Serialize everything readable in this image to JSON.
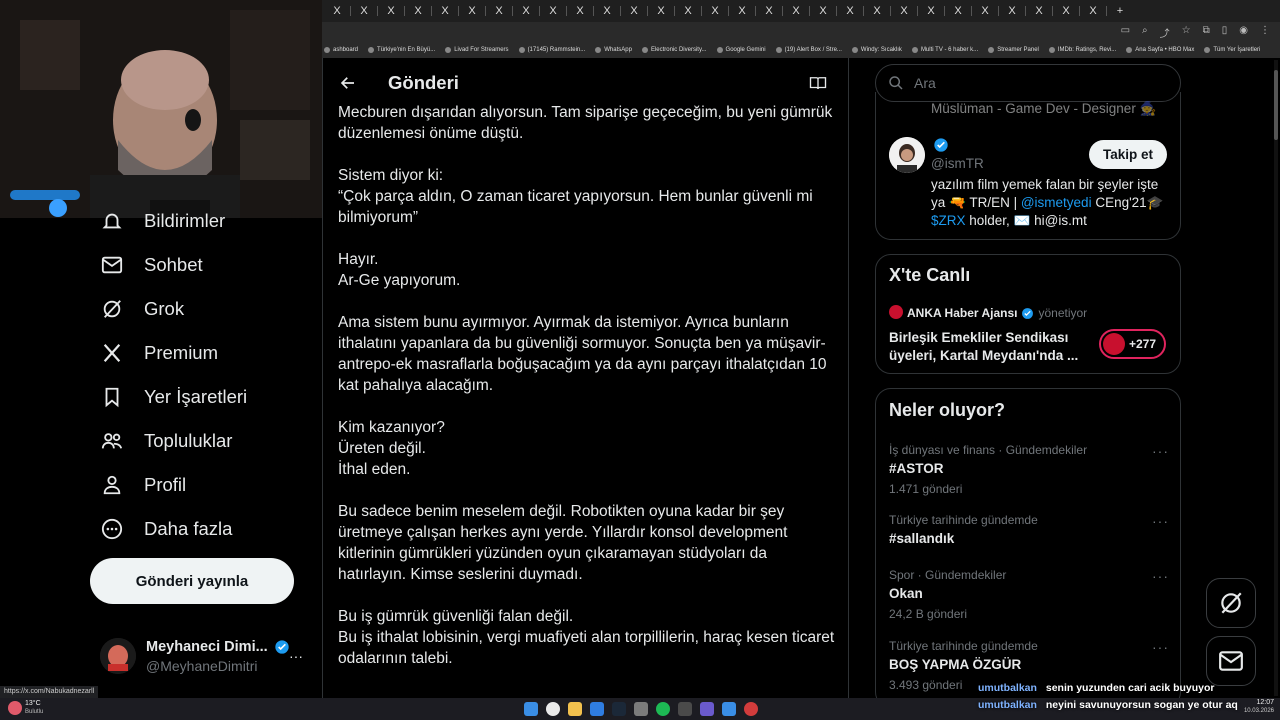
{
  "browser": {
    "tab_close_glyph": "X",
    "new_tab_glyph": "+",
    "bookmarks": [
      "ashboard",
      "Türkiye'nin En Büyü...",
      "Livad For Streamers",
      "(17145) Rammstein...",
      "WhatsApp",
      "Electronic Diversity...",
      "Google Gemini",
      "(19) Alert Box / Stre...",
      "Windy: Sıcaklık",
      "Multi TV - 6 haber k...",
      "Streamer Panel",
      "IMDb: Ratings, Revi...",
      "Ana Sayfa • HBO Max",
      "Tüm Yer İşaretleri"
    ]
  },
  "nav": {
    "items": [
      {
        "label": "Bildirimler",
        "icon": "bell-icon"
      },
      {
        "label": "Sohbet",
        "icon": "envelope-icon"
      },
      {
        "label": "Grok",
        "icon": "grok-icon"
      },
      {
        "label": "Premium",
        "icon": "x-logo-icon"
      },
      {
        "label": "Yer İşaretleri",
        "icon": "bookmark-icon"
      },
      {
        "label": "Topluluklar",
        "icon": "communities-icon"
      },
      {
        "label": "Profil",
        "icon": "person-icon"
      },
      {
        "label": "Daha fazla",
        "icon": "more-circle-icon"
      }
    ],
    "post_button": "Gönderi yayınla",
    "account": {
      "name": "Meyhaneci Dimi...",
      "handle": "@MeyhaneDimitri",
      "more": "···"
    }
  },
  "header": {
    "title": "Gönderi"
  },
  "post": {
    "paragraphs": [
      "Mecburen dışarıdan alıyorsun. Tam siparişe geçeceğim, bu yeni gümrük düzenlemesi önüme düştü.",
      "Sistem diyor ki:\n“Çok parça aldın, O zaman ticaret yapıyorsun. Hem bunlar güvenli mi bilmiyorum”",
      "Hayır.\nAr-Ge yapıyorum.",
      "Ama sistem bunu ayırmıyor. Ayırmak da istemiyor. Ayrıca bunların ithalatını yapanlara da bu güvenliği sormuyor. Sonuçta ben ya müşavir-antrepo-ek masraflarla boğuşacağım ya da aynı parçayı ithalatçıdan 10 kat pahalıya alacağım.",
      "Kim kazanıyor?\nÜreten değil.\nİthal eden.",
      "Bu sadece benim meselem değil. Robotikten oyuna kadar bir şey üretmeye çalışan herkes aynı yerde. Yıllardır konsol development kitlerinin gümrükleri yüzünden oyun çıkaramayan stüdyoları da hatırlayın. Kimse seslerini duymadı.",
      "Bu iş gümrük güvenliği falan değil.\nBu iş ithalat lobisinin, vergi muafiyeti alan torpillilerin, haraç kesen ticaret odalarının talebi."
    ]
  },
  "right": {
    "search_placeholder": "Ara",
    "bio_top": "Müslüman - Game Dev - Designer 🧙",
    "follow_user": {
      "handle": "@ismTR",
      "follow_button": "Takip et",
      "bio_pre": "yazılım film yemek falan bir şeyler işte ya 🔫 TR/EN | ",
      "bio_mention": "@ismetyedi",
      "bio_mid": " CEng'21🎓",
      "bio_cashtag": "$ZRX",
      "bio_post": " holder, ✉️ hi@is.mt"
    },
    "live": {
      "title": "X'te Canlı",
      "host": "ANKA Haber Ajansı",
      "host_role": "yönetiyor",
      "headline": "Birleşik Emekliler Sendikası üyeleri, Kartal Meydanı'nda ...",
      "listeners": "+277"
    },
    "trends_title": "Neler oluyor?",
    "trends": [
      {
        "meta": "İş dünyası ve finans · Gündemdekiler",
        "name": "#ASTOR",
        "count": "1.471 gönderi"
      },
      {
        "meta": "Türkiye tarihinde gündemde",
        "name": "#sallandık",
        "count": ""
      },
      {
        "meta": "Spor · Gündemdekiler",
        "name": "Okan",
        "count": "24,2 B gönderi"
      },
      {
        "meta": "Türkiye tarihinde gündemde",
        "name": "BOŞ YAPMA ÖZGÜR",
        "count": "3.493 gönderi"
      }
    ],
    "more_glyph": "···"
  },
  "chat": [
    {
      "user": "umutbalkan",
      "msg": "senin yuzunden cari acik buyuyor"
    },
    {
      "user": "umutbalkan",
      "msg": "neyini savunuyorsun sogan ye otur aq"
    }
  ],
  "status_url": "https://x.com/Nabukadnezarll",
  "taskbar": {
    "weather_temp": "13°C",
    "weather_desc": "Bulutlu",
    "time": "12:07",
    "date": "10.03.2026"
  },
  "colors": {
    "accent": "#1d9bf0",
    "bg": "#000000",
    "border": "#2f3336",
    "muted": "#71767b",
    "chat_user": "#7fb3ff"
  }
}
